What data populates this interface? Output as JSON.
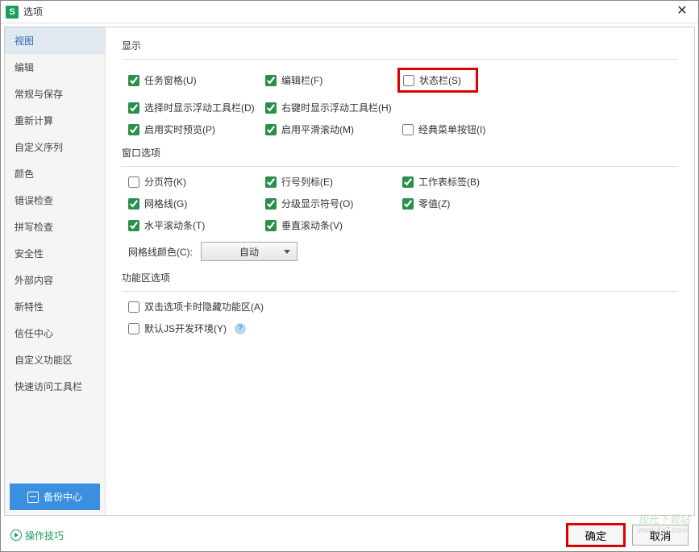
{
  "titlebar": {
    "icon_letter": "S",
    "title": "选项"
  },
  "sidebar": {
    "items": [
      "视图",
      "编辑",
      "常规与保存",
      "重新计算",
      "自定义序列",
      "颜色",
      "错误检查",
      "拼写检查",
      "安全性",
      "外部内容",
      "新特性",
      "信任中心",
      "自定义功能区",
      "快速访问工具栏"
    ],
    "backup_label": "备份中心"
  },
  "sections": {
    "display": {
      "title": "显示",
      "items": [
        {
          "label": "任务窗格(U)",
          "checked": true
        },
        {
          "label": "编辑栏(F)",
          "checked": true
        },
        {
          "label": "状态栏(S)",
          "checked": false,
          "highlight": true
        },
        {
          "label": "选择时显示浮动工具栏(D)",
          "checked": true
        },
        {
          "label": "右键时显示浮动工具栏(H)",
          "checked": true
        },
        {
          "label": "",
          "empty": true
        },
        {
          "label": "启用实时预览(P)",
          "checked": true
        },
        {
          "label": "启用平滑滚动(M)",
          "checked": true
        },
        {
          "label": "经典菜单按钮(I)",
          "checked": false
        }
      ]
    },
    "window": {
      "title": "窗口选项",
      "items": [
        {
          "label": "分页符(K)",
          "checked": false
        },
        {
          "label": "行号列标(E)",
          "checked": true
        },
        {
          "label": "工作表标签(B)",
          "checked": true
        },
        {
          "label": "网格线(G)",
          "checked": true
        },
        {
          "label": "分级显示符号(O)",
          "checked": true
        },
        {
          "label": "零值(Z)",
          "checked": true
        },
        {
          "label": "水平滚动条(T)",
          "checked": true
        },
        {
          "label": "垂直滚动条(V)",
          "checked": true
        }
      ],
      "grid_color_label": "网格线颜色(C):",
      "grid_color_value": "自动"
    },
    "ribbon": {
      "title": "功能区选项",
      "items": [
        {
          "label": "双击选项卡时隐藏功能区(A)",
          "checked": false
        },
        {
          "label": "默认JS开发环境(Y)",
          "checked": false,
          "help": true
        }
      ]
    }
  },
  "footer": {
    "tips": "操作技巧",
    "ok": "确定",
    "cancel": "取消"
  },
  "watermark": {
    "line1": "极光下载站",
    "line2": "www.kz7.com"
  }
}
